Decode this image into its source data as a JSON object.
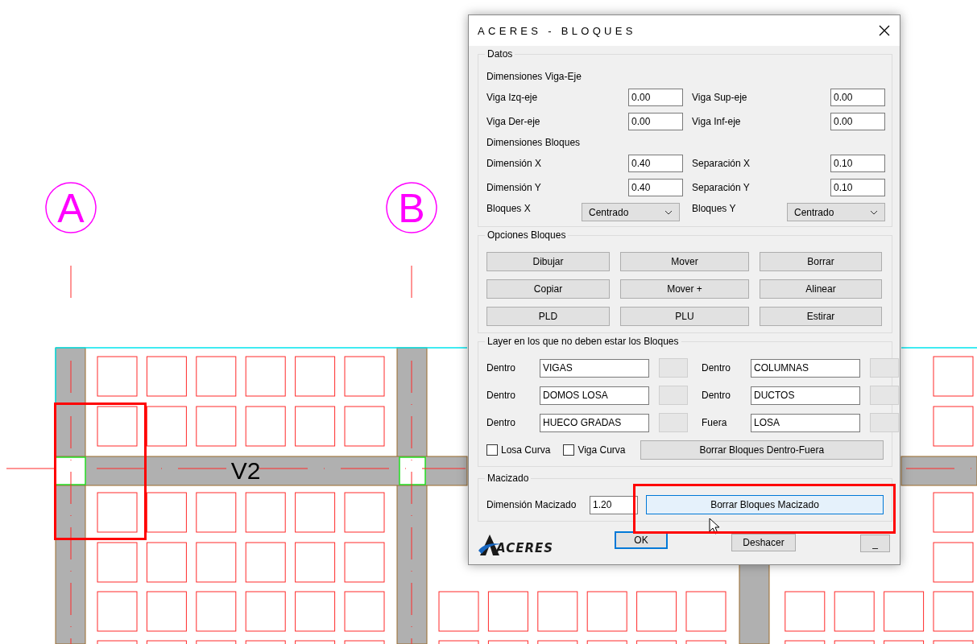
{
  "drawing": {
    "axes": [
      {
        "label": "A"
      },
      {
        "label": "B"
      }
    ],
    "beam_label": "V2"
  },
  "dialog": {
    "title": "ACERES - BLOQUES",
    "datos": {
      "title": "Datos",
      "rows": [
        {
          "kind": "heading",
          "text": "Dimensiones Viga-Eje"
        },
        {
          "kind": "pair",
          "items": [
            {
              "label": "Viga Izq-eje",
              "value": "0.00"
            },
            {
              "label": "Viga Sup-eje",
              "value": "0.00"
            }
          ]
        },
        {
          "kind": "pair",
          "items": [
            {
              "label": "Viga Der-eje",
              "value": "0.00"
            },
            {
              "label": "Viga Inf-eje",
              "value": "0.00"
            }
          ]
        },
        {
          "kind": "heading",
          "text": "Dimensiones Bloques"
        },
        {
          "kind": "pair",
          "items": [
            {
              "label": "Dimensión X",
              "value": "0.40"
            },
            {
              "label": "Separación X",
              "value": "0.10"
            }
          ]
        },
        {
          "kind": "pair",
          "items": [
            {
              "label": "Dimensión Y",
              "value": "0.40"
            },
            {
              "label": "Separación Y",
              "value": "0.10"
            }
          ]
        },
        {
          "kind": "select",
          "items": [
            {
              "label": "Bloques X",
              "value": "Centrado"
            },
            {
              "label": "Bloques Y",
              "value": "Centrado"
            }
          ]
        }
      ]
    },
    "opciones": {
      "title": "Opciones Bloques",
      "buttons": [
        "Dibujar",
        "Mover",
        "Borrar",
        "Copiar",
        "Mover +",
        "Alinear",
        "PLD",
        "PLU",
        "Estirar"
      ]
    },
    "layers": {
      "title": "Layer en los que no deben estar los Bloques",
      "rows": [
        {
          "label": "Dentro",
          "value": "VIGAS"
        },
        {
          "label": "Dentro",
          "value": "COLUMNAS"
        },
        {
          "label": "Dentro",
          "value": "DOMOS LOSA"
        },
        {
          "label": "Dentro",
          "value": "DUCTOS"
        },
        {
          "label": "Dentro",
          "value": "HUECO GRADAS"
        },
        {
          "label": "Fuera",
          "value": "LOSA"
        }
      ],
      "checkboxes": [
        {
          "label": "Losa Curva",
          "checked": false
        },
        {
          "label": "Viga Curva",
          "checked": false
        }
      ],
      "button": "Borrar Bloques Dentro-Fuera"
    },
    "macizado": {
      "title": "Macizado",
      "label": "Dimensión Macizado",
      "value": "1.20",
      "button": {
        "label": "Borrar Bloques Macizado",
        "hovered": true
      }
    },
    "footer": {
      "logo": "ACERES",
      "buttons": [
        {
          "label": "OK",
          "default": true
        },
        {
          "label": "Deshacer",
          "default": false
        },
        {
          "label": "_",
          "default": false
        }
      ]
    }
  }
}
